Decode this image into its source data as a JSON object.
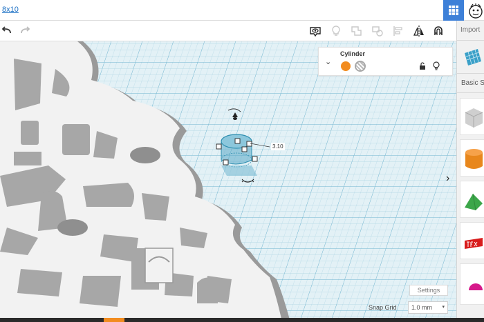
{
  "topbar": {
    "project_title": "8x10"
  },
  "right_panel": {
    "import_label": "Import",
    "basic_shapes_label": "Basic Sh"
  },
  "inspector": {
    "shape_name": "Cylinder",
    "solid_color": "#f28c1f"
  },
  "selection": {
    "dimension": "3.10"
  },
  "workplane": {
    "settings_label": "Settings",
    "snap_grid_label": "Snap Grid",
    "snap_grid_value": "1.0 mm"
  },
  "colors": {
    "accent": "#3d80d8",
    "grid_bg": "#d9ecf3",
    "grid_line": "#9fcbdd",
    "grid_major": "#5aa8c6",
    "model_top": "#f3f3f3",
    "model_side": "#9e9e9e",
    "selection": "#2f8fb0"
  },
  "icons": [
    "undo-icon",
    "redo-icon",
    "visibility-icon",
    "light-bulb-icon",
    "group-icon",
    "ungroup-icon",
    "align-icon",
    "mirror-icon",
    "magnet-icon",
    "grid-view-icon",
    "lock-icon",
    "chevron-right-icon"
  ]
}
